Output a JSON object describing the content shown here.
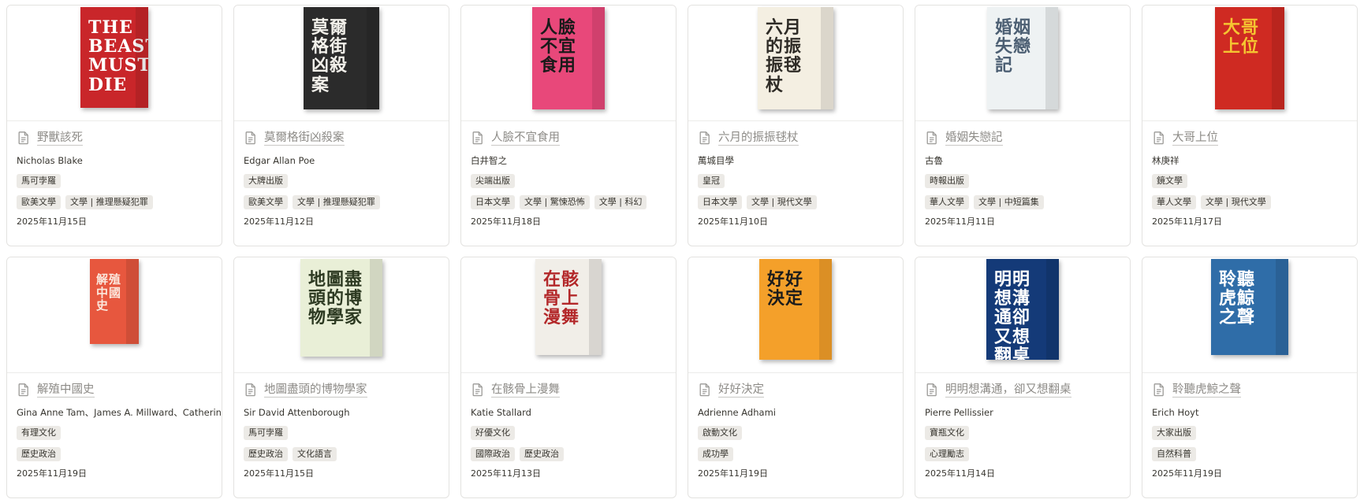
{
  "books": [
    {
      "title": "野獸該死",
      "author": "Nicholas Blake",
      "publisher": "馬可孛羅",
      "categories": [
        "歐美文學",
        "文學 | 推理懸疑犯罪"
      ],
      "date": "2025年11月15日",
      "cover": {
        "bg": "#c9262a",
        "fg": "#ffffff",
        "text": "THE BEAST MUST DIE"
      }
    },
    {
      "title": "莫爾格街凶殺案",
      "author": "Edgar Allan Poe",
      "publisher": "大牌出版",
      "categories": [
        "歐美文學",
        "文學 | 推理懸疑犯罪"
      ],
      "date": "2025年11月12日",
      "cover": {
        "bg": "#2b2b2b",
        "fg": "#f2f0ea",
        "text": "莫爾格街凶殺案"
      }
    },
    {
      "title": "人臉不宜食用",
      "author": "白井智之",
      "publisher": "尖端出版",
      "categories": [
        "日本文學",
        "文學 | 驚悚恐怖",
        "文學 | 科幻"
      ],
      "date": "2025年11月18日",
      "cover": {
        "bg": "#e8487a",
        "fg": "#1a1a1a",
        "text": "人臉不宜食用"
      }
    },
    {
      "title": "六月的振振毬杖",
      "author": "萬城目學",
      "publisher": "皇冠",
      "categories": [
        "日本文學",
        "文學 | 現代文學"
      ],
      "date": "2025年11月10日",
      "cover": {
        "bg": "#f4efe2",
        "fg": "#2e2b26",
        "text": "六月的振振毬杖"
      }
    },
    {
      "title": "婚姻失戀記",
      "author": "古魯",
      "publisher": "時報出版",
      "categories": [
        "華人文學",
        "文學 | 中短篇集"
      ],
      "date": "2025年11月11日",
      "cover": {
        "bg": "#eef2f3",
        "fg": "#4c5f73",
        "text": "婚姻失戀記"
      }
    },
    {
      "title": "大哥上位",
      "author": "林庚祥",
      "publisher": "鏡文學",
      "categories": [
        "華人文學",
        "文學 | 現代文學"
      ],
      "date": "2025年11月17日",
      "cover": {
        "bg": "#cf2a22",
        "fg": "#f5c531",
        "text": "大哥上位"
      }
    },
    {
      "title": "解殖中國史",
      "author": "Gina Anne Tam、James A. Millward、Catherine Lil",
      "publisher": "有理文化",
      "categories": [
        "歷史政治"
      ],
      "date": "2025年11月19日",
      "cover": {
        "bg": "#e7573e",
        "fg": "#fbe7dc",
        "text": "解殖中國史"
      }
    },
    {
      "title": "地圖盡頭的博物學家",
      "author": "Sir David Attenborough",
      "publisher": "馬可孛羅",
      "categories": [
        "歷史政治",
        "文化語言"
      ],
      "date": "2025年11月15日",
      "cover": {
        "bg": "#e9efd7",
        "fg": "#2d3a22",
        "text": "地圖盡頭的博物學家"
      }
    },
    {
      "title": "在骸骨上漫舞",
      "author": "Katie Stallard",
      "publisher": "好優文化",
      "categories": [
        "國際政治",
        "歷史政治"
      ],
      "date": "2025年11月13日",
      "cover": {
        "bg": "#f1eee8",
        "fg": "#b3282a",
        "text": "在骸骨上漫舞"
      }
    },
    {
      "title": "好好決定",
      "author": "Adrienne Adhami",
      "publisher": "啟動文化",
      "categories": [
        "成功學"
      ],
      "date": "2025年11月19日",
      "cover": {
        "bg": "#f4a02a",
        "fg": "#1c1c1c",
        "text": "好好決定"
      }
    },
    {
      "title": "明明想溝通，卻又想翻桌",
      "author": "Pierre Pellissier",
      "publisher": "寶瓶文化",
      "categories": [
        "心理勵志"
      ],
      "date": "2025年11月14日",
      "cover": {
        "bg": "#143a78",
        "fg": "#ffffff",
        "text": "明明想溝通卻又想翻桌"
      }
    },
    {
      "title": "聆聽虎鯨之聲",
      "author": "Erich Hoyt",
      "publisher": "大家出版",
      "categories": [
        "自然科普"
      ],
      "date": "2025年11月19日",
      "cover": {
        "bg": "#2f6da8",
        "fg": "#ffffff",
        "text": "聆聽虎鯨之聲"
      }
    }
  ]
}
